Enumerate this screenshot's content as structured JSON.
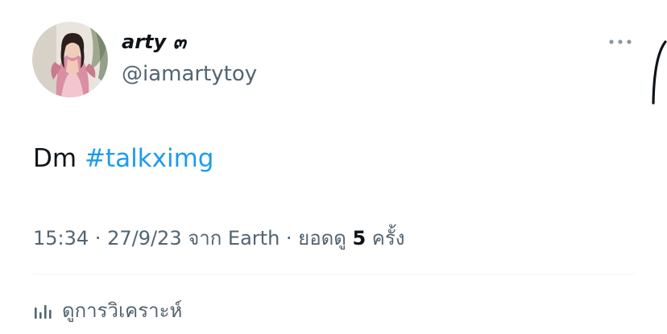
{
  "author": {
    "display_name": "arty ๓",
    "handle": "@iamartytoy",
    "avatar_icon": "profile-photo"
  },
  "tweet": {
    "text_prefix": "Dm ",
    "hashtag": "#talkximg"
  },
  "meta": {
    "time": "15:34",
    "sep1": " · ",
    "date": "27/9/23",
    "source": " จาก Earth",
    "sep2": " · ",
    "views_prefix": "ยอดดู ",
    "views_count": "5",
    "views_suffix": " ครั้ง"
  },
  "actions": {
    "more_icon": "more-horizontal-icon",
    "analytics_icon": "bar-chart-icon",
    "analytics_label": "ดูการวิเคราะห์"
  },
  "colors": {
    "text_primary": "#0f1419",
    "text_secondary": "#536471",
    "link": "#1d9bf0",
    "divider": "#eff3f4"
  }
}
